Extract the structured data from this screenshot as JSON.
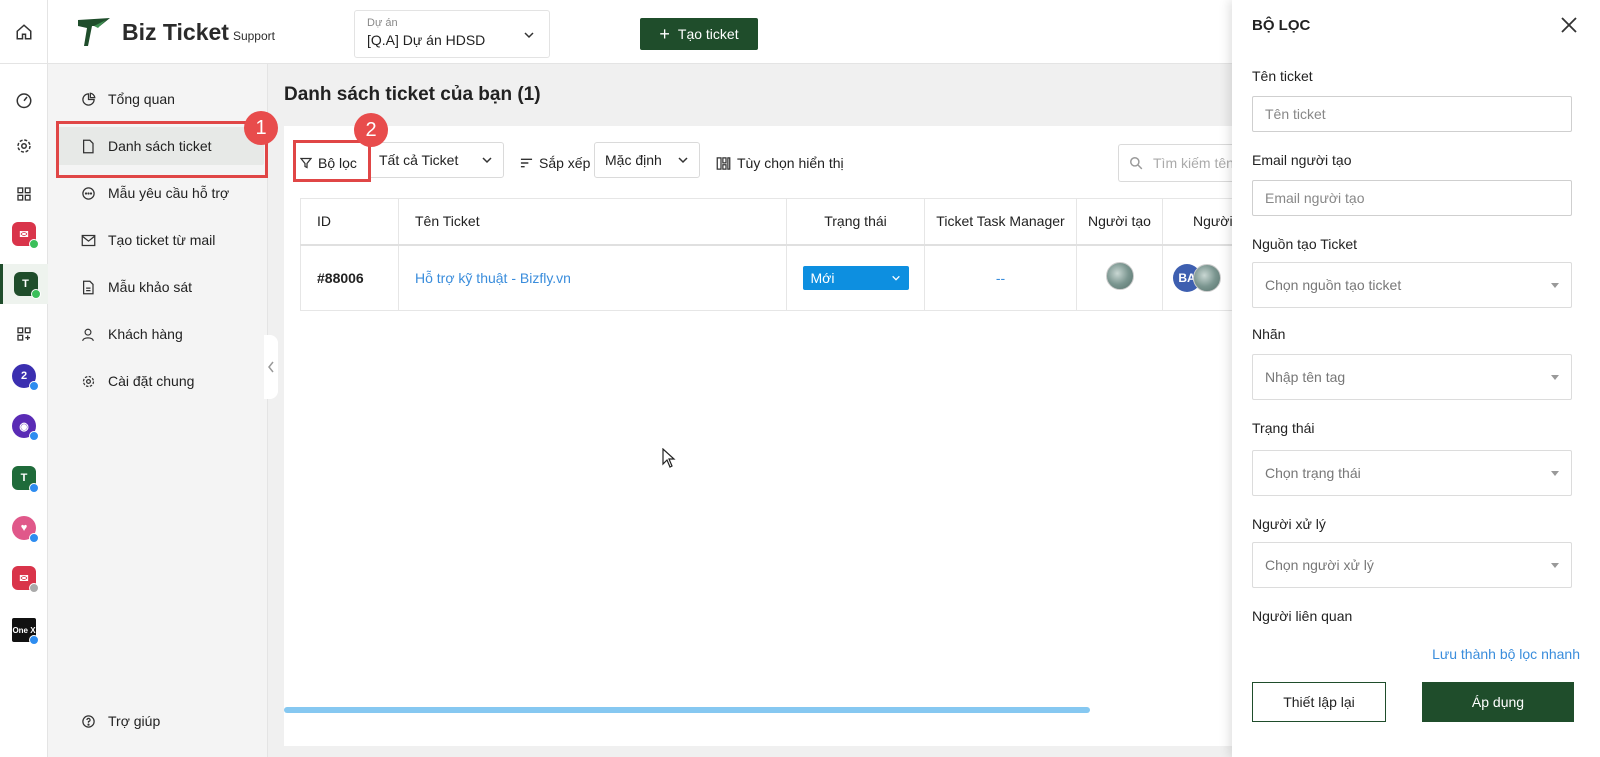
{
  "header": {
    "logo_text": "Biz Ticket",
    "logo_sub": "Support",
    "project_label": "Dự án",
    "project_value": "[Q.A] Dự án HDSD",
    "create_button": "Tạo ticket"
  },
  "rail": {
    "icons": [
      "home-icon",
      "dashboard-icon",
      "gear-icon",
      "grid-icon",
      "bizmail-app-icon",
      "bizticket-app-icon",
      "grid-add-icon",
      "bizfly-app-icon",
      "bot-app-icon",
      "bizticket-app-icon",
      "bizcrm-app-icon",
      "bizmail-app-icon",
      "onex-app-icon"
    ],
    "onex_label": "One X"
  },
  "sidebar": {
    "items": [
      {
        "label": "Tổng quan",
        "icon": "pie-chart-icon"
      },
      {
        "label": "Danh sách ticket",
        "icon": "document-icon"
      },
      {
        "label": "Mẫu yêu cầu hỗ trợ",
        "icon": "chat-icon"
      },
      {
        "label": "Tạo ticket từ mail",
        "icon": "mail-icon"
      },
      {
        "label": "Mẫu khảo sát",
        "icon": "document-icon"
      },
      {
        "label": "Khách hàng",
        "icon": "user-icon"
      },
      {
        "label": "Cài đặt chung",
        "icon": "gear-icon"
      }
    ],
    "help": "Trợ giúp"
  },
  "main": {
    "title": "Danh sách ticket của bạn (1)",
    "toolbar": {
      "filter": "Bộ lọc",
      "ticket_scope": "Tất cả Ticket",
      "sort_label": "Sắp xếp",
      "sort_value": "Mặc định",
      "display_options": "Tùy chọn hiển thị",
      "search_placeholder": "Tìm kiếm tên"
    },
    "table": {
      "columns": [
        "ID",
        "Tên Ticket",
        "Trạng thái",
        "Ticket Task Manager",
        "Người tạo",
        "Người"
      ],
      "rows": [
        {
          "id": "#88006",
          "name": "Hỗ trợ kỹ thuật - Bizfly.vn",
          "status": "Mới",
          "task_manager": "--",
          "assignee_initials": "BA"
        }
      ]
    }
  },
  "annotations": [
    "1",
    "2"
  ],
  "filter_panel": {
    "title": "BỘ LỌC",
    "fields": [
      {
        "label": "Tên ticket",
        "placeholder": "Tên ticket"
      },
      {
        "label": "Email người tạo",
        "placeholder": "Email người tạo"
      },
      {
        "label": "Nguồn tạo Ticket",
        "placeholder": "Chọn nguồn tạo ticket"
      },
      {
        "label": "Nhãn",
        "placeholder": "Nhập tên tag"
      },
      {
        "label": "Trạng thái",
        "placeholder": "Chọn trạng thái"
      },
      {
        "label": "Người xử lý",
        "placeholder": "Chọn người xử lý"
      },
      {
        "label": "Người liên quan"
      }
    ],
    "save_quick": "Lưu thành bộ lọc nhanh",
    "reset": "Thiết lập lại",
    "apply": "Áp dụng"
  },
  "colors": {
    "brand": "#1f4d2b",
    "link": "#3a8ddc",
    "status_new": "#0d8fe0",
    "annotation": "#e04646"
  }
}
